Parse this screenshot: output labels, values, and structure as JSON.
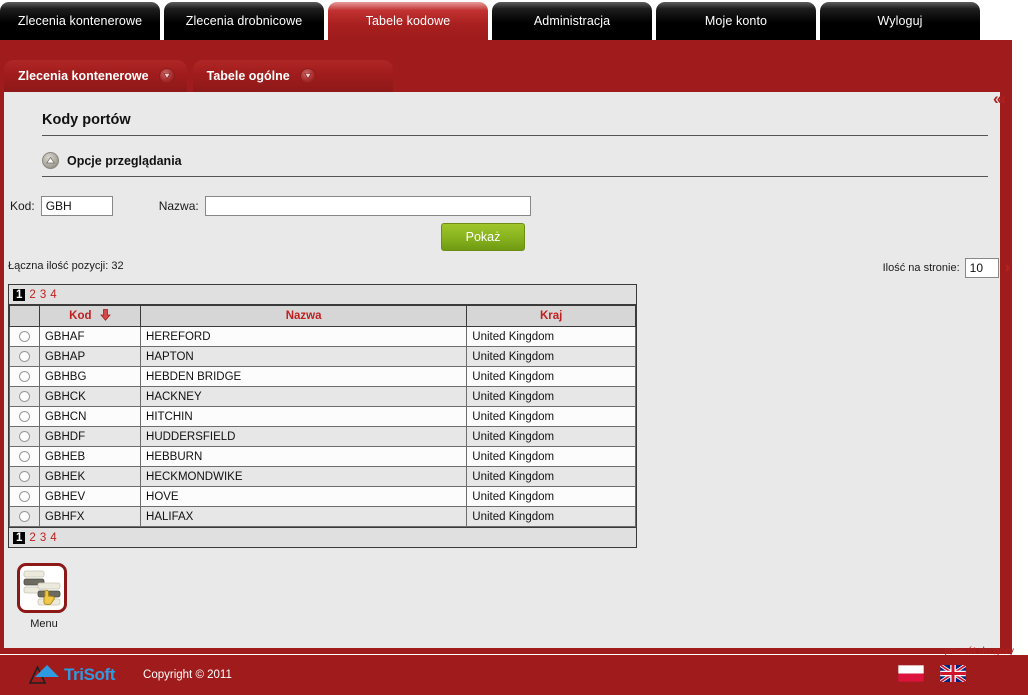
{
  "top_nav": {
    "tabs": [
      {
        "label": "Zlecenia kontenerowe",
        "active": false
      },
      {
        "label": "Zlecenia drobnicowe",
        "active": false
      },
      {
        "label": "Tabele kodowe",
        "active": true
      },
      {
        "label": "Administracja",
        "active": false
      },
      {
        "label": "Moje konto",
        "active": false
      },
      {
        "label": "Wyloguj",
        "active": false
      }
    ]
  },
  "sub_nav": {
    "tabs": [
      {
        "label": "Zlecenia kontenerowe",
        "icon": "circle-down-arrow-icon"
      },
      {
        "label": "Tabele ogólne",
        "icon": "circle-down-arrow-icon"
      }
    ]
  },
  "content": {
    "collapse_icon": "triple-chevron-left-icon",
    "page_title": "Kody portów",
    "options_section": {
      "icon": "circle-up-arrow-icon",
      "title": "Opcje przeglądania"
    },
    "form": {
      "kod_label": "Kod:",
      "kod_value": "GBH",
      "kod_placeholder": "",
      "nazwa_label": "Nazwa:",
      "nazwa_value": "",
      "nazwa_placeholder": "",
      "submit_label": "Pokaż"
    },
    "total_count_text": "Łączna ilość pozycji: 32",
    "per_page": {
      "label": "Ilość na stronie:",
      "value": "10",
      "next_icon": "chevron-right-icon"
    }
  },
  "pager": {
    "pages": [
      "1",
      "2",
      "3",
      "4"
    ],
    "current": "1"
  },
  "table": {
    "columns": [
      {
        "label": "",
        "key": "select"
      },
      {
        "label": "Kod",
        "key": "kod",
        "sorted": true,
        "sort_icon": "sort-down-arrow-icon"
      },
      {
        "label": "Nazwa",
        "key": "nazwa"
      },
      {
        "label": "Kraj",
        "key": "kraj"
      }
    ],
    "rows": [
      {
        "kod": "GBHAF",
        "nazwa": "HEREFORD",
        "kraj": "United Kingdom"
      },
      {
        "kod": "GBHAP",
        "nazwa": "HAPTON",
        "kraj": "United Kingdom"
      },
      {
        "kod": "GBHBG",
        "nazwa": "HEBDEN BRIDGE",
        "kraj": "United Kingdom"
      },
      {
        "kod": "GBHCK",
        "nazwa": "HACKNEY",
        "kraj": "United Kingdom"
      },
      {
        "kod": "GBHCN",
        "nazwa": "HITCHIN",
        "kraj": "United Kingdom"
      },
      {
        "kod": "GBHDF",
        "nazwa": "HUDDERSFIELD",
        "kraj": "United Kingdom"
      },
      {
        "kod": "GBHEB",
        "nazwa": "HEBBURN",
        "kraj": "United Kingdom"
      },
      {
        "kod": "GBHEK",
        "nazwa": "HECKMONDWIKE",
        "kraj": "United Kingdom"
      },
      {
        "kod": "GBHEV",
        "nazwa": "HOVE",
        "kraj": "United Kingdom"
      },
      {
        "kod": "GBHFX",
        "nazwa": "HALIFAX",
        "kraj": "United Kingdom"
      }
    ]
  },
  "menu_button": {
    "label": "Menu",
    "icon": "menu-list-hand-icon"
  },
  "back_to_top": "powrót do góry",
  "footer": {
    "logo_text": "TriSoft",
    "logo_icon": "trisoft-triangle-icon",
    "copyright": "Copyright © 2011",
    "flags": [
      {
        "name": "flag-pl-icon",
        "title": "Polski"
      },
      {
        "name": "flag-gb-icon",
        "title": "English"
      }
    ]
  },
  "colors": {
    "brand_red": "#a01c1c",
    "accent_red": "#c02020",
    "panel_gray": "#e9e9e9",
    "button_green": "#8ab51f",
    "logo_blue": "#2e9ae0"
  }
}
